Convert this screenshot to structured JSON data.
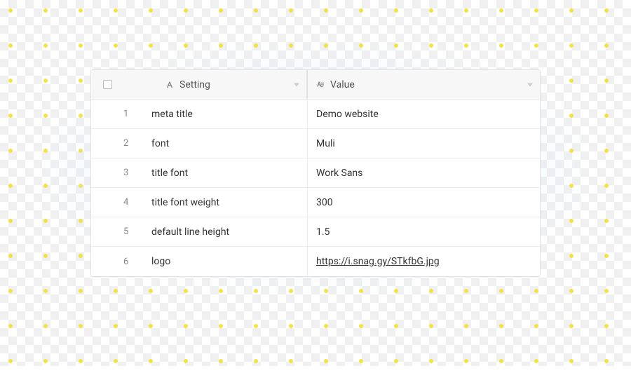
{
  "table": {
    "columns": {
      "setting_label": "Setting",
      "value_label": "Value"
    },
    "rows": [
      {
        "idx": "1",
        "setting": "meta title",
        "value": "Demo website",
        "link": false
      },
      {
        "idx": "2",
        "setting": "font",
        "value": "Muli",
        "link": false
      },
      {
        "idx": "3",
        "setting": "title font",
        "value": "Work Sans",
        "link": false
      },
      {
        "idx": "4",
        "setting": "title font weight",
        "value": "300",
        "link": false
      },
      {
        "idx": "5",
        "setting": "default line height",
        "value": "1.5",
        "link": false
      },
      {
        "idx": "6",
        "setting": "logo",
        "value": "https://i.snag.gy/STkfbG.jpg",
        "link": true
      }
    ]
  }
}
